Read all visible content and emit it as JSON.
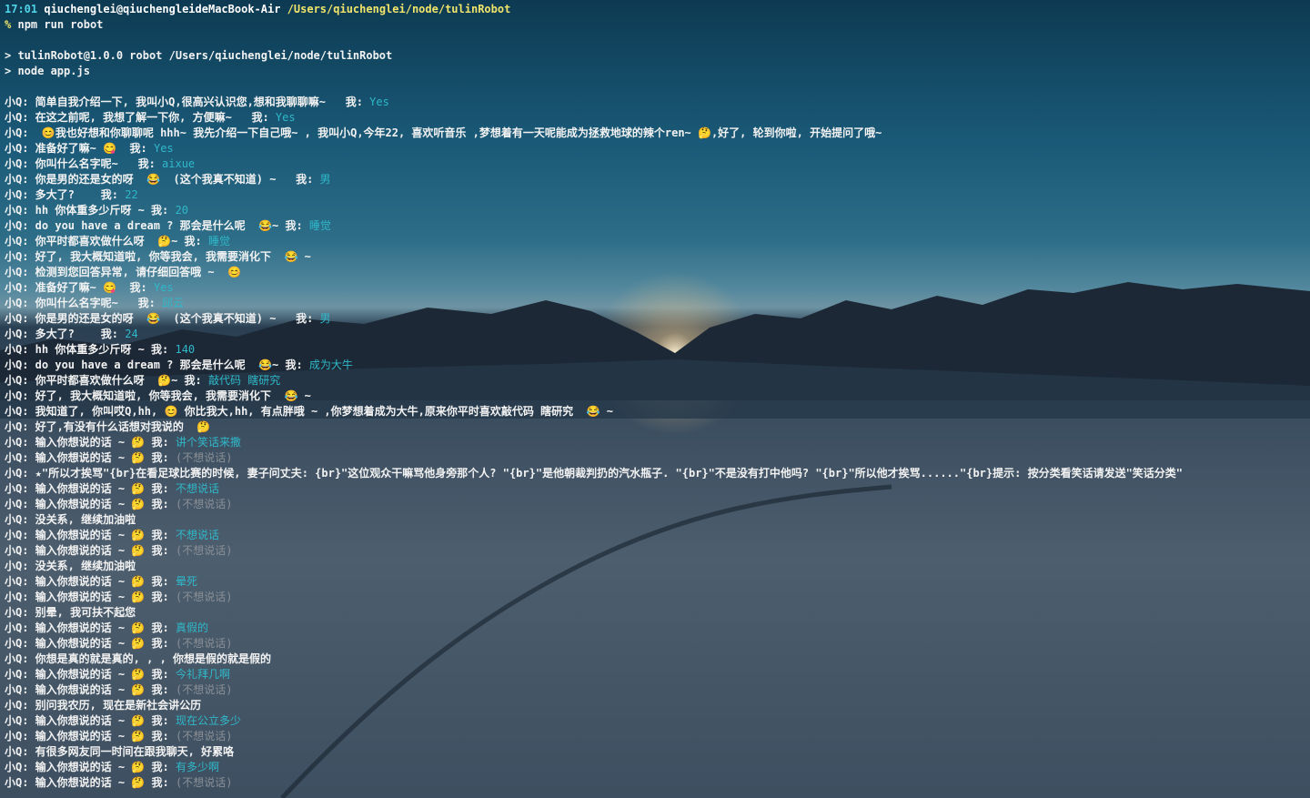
{
  "prompt": {
    "time": "17:01",
    "user_host": "qiuchenglei@qiuchengleideMacBook-Air",
    "path": "/Users/qiuchenglei/node/tulinRobot",
    "symbol": "%",
    "command": "npm run robot"
  },
  "npm_output": [
    "> tulinRobot@1.0.0 robot /Users/qiuchenglei/node/tulinRobot",
    "> node app.js"
  ],
  "icons": {
    "emoji": "emoji-face-icon"
  },
  "colors": {
    "answer": "#2fb8c9",
    "muted": "#8a8f96",
    "path": "#f0e46a",
    "time": "#4fd3e6"
  },
  "lines": [
    {
      "q": "小Q: 简单自我介绍一下, 我叫小Q,很高兴认识您,想和我聊聊嘛~   我: ",
      "a": "Yes",
      "e": false
    },
    {
      "q": "小Q: 在这之前呢, 我想了解一下你, 方便嘛~   我: ",
      "a": "Yes",
      "e": false
    },
    {
      "q": "小Q:  😊我也好想和你聊聊呢 hhh~ 我先介绍一下自己哦~ , 我叫小Q,今年22, 喜欢听音乐 ,梦想着有一天呢能成为拯救地球的辣个ren~ 🤔,好了, 轮到你啦, 开始提问了哦~",
      "a": "",
      "e": false
    },
    {
      "q": "小Q: 准备好了嘛~ 😋  我: ",
      "a": "Yes",
      "e": false
    },
    {
      "q": "小Q: 你叫什么名字呢~   我: ",
      "a": "aixue",
      "e": false
    },
    {
      "q": "小Q: 你是男的还是女的呀  😂  (这个我真不知道) ~   我: ",
      "a": "男",
      "e": false
    },
    {
      "q": "小Q: 多大了?    我: ",
      "a": "22",
      "e": false
    },
    {
      "q": "小Q: hh 你体重多少斤呀 ~ 我: ",
      "a": "20",
      "e": false
    },
    {
      "q": "小Q: do you have a dream ? 那会是什么呢  😂~ 我: ",
      "a": "睡觉",
      "e": false
    },
    {
      "q": "小Q: 你平时都喜欢做什么呀  🤔~ 我: ",
      "a": "睡觉",
      "e": false
    },
    {
      "q": "小Q: 好了, 我大概知道啦, 你等我会, 我需要消化下  😂 ~",
      "a": "",
      "e": false
    },
    {
      "q": "小Q: 检测到您回答异常, 请仔细回答哦 ~  😊",
      "a": "",
      "e": false
    },
    {
      "q": "小Q: 准备好了嘛~ 😋  我: ",
      "a": "Yes",
      "e": false
    },
    {
      "q": "小Q: 你叫什么名字呢~   我: ",
      "a": "邱云",
      "e": false
    },
    {
      "q": "小Q: 你是男的还是女的呀  😂  (这个我真不知道) ~   我: ",
      "a": "男",
      "e": false
    },
    {
      "q": "小Q: 多大了?    我: ",
      "a": "24",
      "e": false
    },
    {
      "q": "小Q: hh 你体重多少斤呀 ~ 我: ",
      "a": "140",
      "e": false
    },
    {
      "q": "小Q: do you have a dream ? 那会是什么呢  😂~ 我: ",
      "a": "成为大牛",
      "e": false
    },
    {
      "q": "小Q: 你平时都喜欢做什么呀  🤔~ 我: ",
      "a": "敲代码 瞎研究",
      "e": false
    },
    {
      "q": "小Q: 好了, 我大概知道啦, 你等我会, 我需要消化下  😂 ~",
      "a": "",
      "e": false
    },
    {
      "q": "小Q: 我知道了, 你叫哎Q,hh, 😊 你比我大,hh, 有点胖哦 ~ ,你梦想着成为大牛,原来你平时喜欢敲代码 瞎研究  😂 ~",
      "a": "",
      "e": false
    },
    {
      "q": "小Q: 好了,有没有什么话想对我说的  🤔",
      "a": "",
      "e": false
    },
    {
      "q": "小Q: 输入你想说的话 ~ 🤔 我: ",
      "a": "讲个笑话来撒",
      "e": false
    },
    {
      "q": "小Q: 输入你想说的话 ~ 🤔 我: ",
      "a": "(不想说话)",
      "e": true
    },
    {
      "q": "小Q: ★\"所以才挨骂\"{br}在看足球比赛的时候, 妻子问丈夫: {br}\"这位观众干嘛骂他身旁那个人? \"{br}\"是他朝裁判扔的汽水瓶子. \"{br}\"不是没有打中他吗? \"{br}\"所以他才挨骂......\"{br}提示: 按分类看笑话请发送\"笑话分类\"",
      "a": "",
      "e": false
    },
    {
      "q": "小Q: 输入你想说的话 ~ 🤔 我: ",
      "a": "不想说话",
      "e": false
    },
    {
      "q": "小Q: 输入你想说的话 ~ 🤔 我: ",
      "a": "(不想说话)",
      "e": true
    },
    {
      "q": "小Q: 没关系, 继续加油啦",
      "a": "",
      "e": false
    },
    {
      "q": "小Q: 输入你想说的话 ~ 🤔 我: ",
      "a": "不想说话",
      "e": false
    },
    {
      "q": "小Q: 输入你想说的话 ~ 🤔 我: ",
      "a": "(不想说话)",
      "e": true
    },
    {
      "q": "小Q: 没关系, 继续加油啦",
      "a": "",
      "e": false
    },
    {
      "q": "小Q: 输入你想说的话 ~ 🤔 我: ",
      "a": "晕死",
      "e": false
    },
    {
      "q": "小Q: 输入你想说的话 ~ 🤔 我: ",
      "a": "(不想说话)",
      "e": true
    },
    {
      "q": "小Q: 别晕, 我可扶不起您",
      "a": "",
      "e": false
    },
    {
      "q": "小Q: 输入你想说的话 ~ 🤔 我: ",
      "a": "真假的",
      "e": false
    },
    {
      "q": "小Q: 输入你想说的话 ~ 🤔 我: ",
      "a": "(不想说话)",
      "e": true
    },
    {
      "q": "小Q: 你想是真的就是真的, , , 你想是假的就是假的",
      "a": "",
      "e": false
    },
    {
      "q": "小Q: 输入你想说的话 ~ 🤔 我: ",
      "a": "今礼拜几啊",
      "e": false
    },
    {
      "q": "小Q: 输入你想说的话 ~ 🤔 我: ",
      "a": "(不想说话)",
      "e": true
    },
    {
      "q": "小Q: 别问我农历, 现在是新社会讲公历",
      "a": "",
      "e": false
    },
    {
      "q": "小Q: 输入你想说的话 ~ 🤔 我: ",
      "a": "现在公立多少",
      "e": false
    },
    {
      "q": "小Q: 输入你想说的话 ~ 🤔 我: ",
      "a": "(不想说话)",
      "e": true
    },
    {
      "q": "小Q: 有很多网友同一时间在跟我聊天, 好累咯",
      "a": "",
      "e": false
    },
    {
      "q": "小Q: 输入你想说的话 ~ 🤔 我: ",
      "a": "有多少啊",
      "e": false
    },
    {
      "q": "小Q: 输入你想说的话 ~ 🤔 我: ",
      "a": "(不想说话)",
      "e": true
    }
  ]
}
